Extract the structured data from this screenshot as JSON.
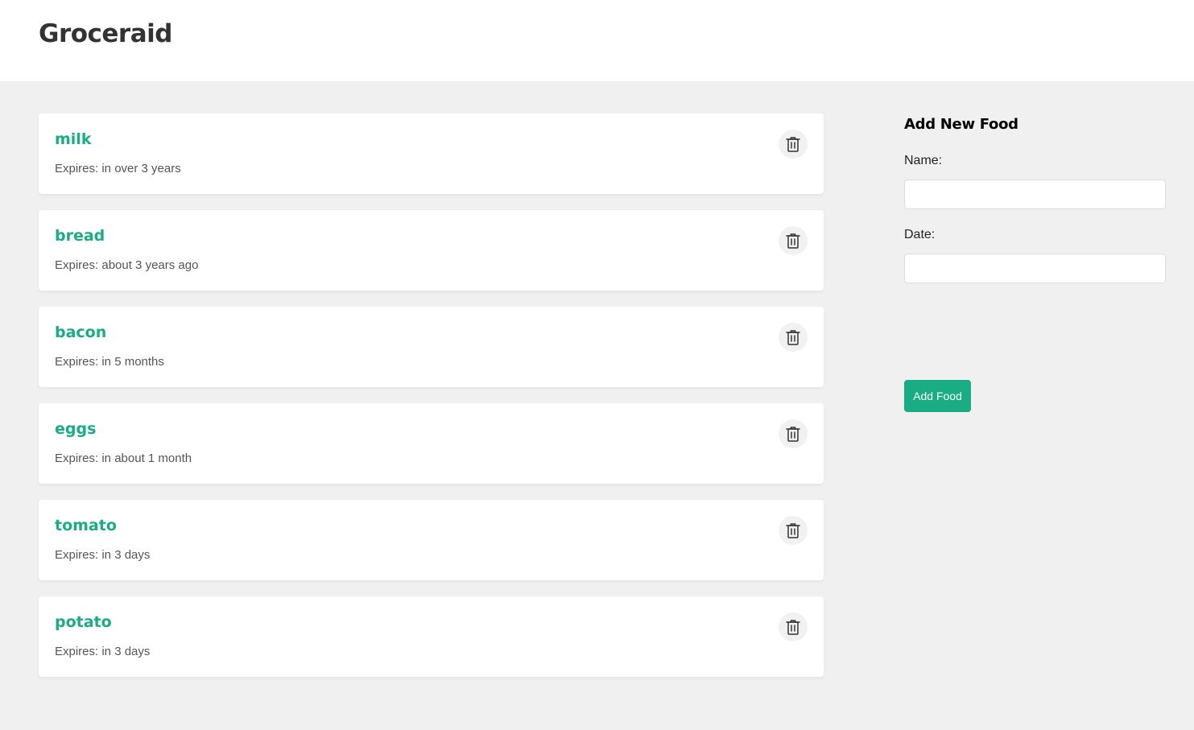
{
  "app": {
    "title": "Groceraid"
  },
  "colors": {
    "accent": "#1aac83",
    "background": "#f0f0f0",
    "card": "#ffffff",
    "delete_bg": "#f1f1f1"
  },
  "foods": [
    {
      "name": "milk",
      "expiry": "Expires: in over 3 years",
      "delete_icon": "trash-icon"
    },
    {
      "name": "bread",
      "expiry": "Expires: about 3 years ago",
      "delete_icon": "trash-icon"
    },
    {
      "name": "bacon",
      "expiry": "Expires: in 5 months",
      "delete_icon": "trash-icon"
    },
    {
      "name": "eggs",
      "expiry": "Expires: in about 1 month",
      "delete_icon": "trash-icon"
    },
    {
      "name": "tomato",
      "expiry": "Expires: in 3 days",
      "delete_icon": "trash-icon"
    },
    {
      "name": "potato",
      "expiry": "Expires: in 3 days",
      "delete_icon": "trash-icon"
    }
  ],
  "form": {
    "title": "Add New Food",
    "name_label": "Name:",
    "name_value": "",
    "date_label": "Date:",
    "date_value": "",
    "submit_label": "Add Food"
  }
}
